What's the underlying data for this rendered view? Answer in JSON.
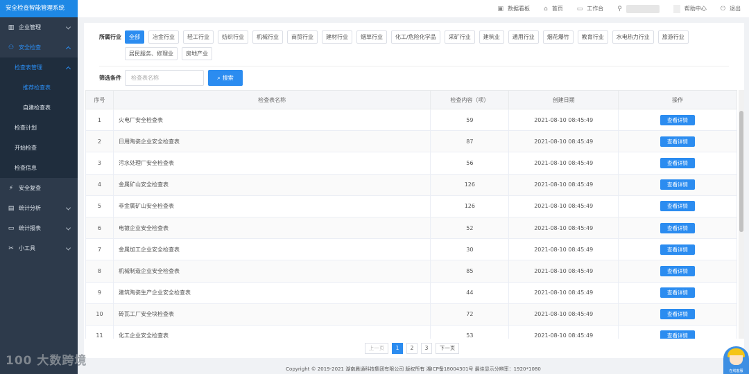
{
  "app": {
    "title": "安全检查智能管理系统"
  },
  "header": {
    "items": [
      {
        "label": "数据看板",
        "icon": "monitor-icon"
      },
      {
        "label": "首页",
        "icon": "home-icon"
      },
      {
        "label": "工作台",
        "icon": "desktop-icon"
      },
      {
        "label": "帮助中心",
        "icon": "help-icon"
      },
      {
        "label": "退出",
        "icon": "power-icon"
      }
    ]
  },
  "sidebar": {
    "items": [
      {
        "label": "企业管理",
        "icon": "building-icon"
      },
      {
        "label": "安全检查",
        "icon": "users-icon"
      },
      {
        "label": "检查表管理"
      },
      {
        "label": "推荐检查表"
      },
      {
        "label": "自建检查表"
      },
      {
        "label": "检查计划"
      },
      {
        "label": "开始检查"
      },
      {
        "label": "检查信息"
      },
      {
        "label": "安全复查",
        "icon": "bolt-icon"
      },
      {
        "label": "统计分析",
        "icon": "clipboard-icon"
      },
      {
        "label": "统计报表",
        "icon": "folder-icon"
      },
      {
        "label": "小工具",
        "icon": "tools-icon"
      }
    ]
  },
  "filter": {
    "label": "所属行业",
    "tags": [
      "全部",
      "冶金行业",
      "轻工行业",
      "纺织行业",
      "机械行业",
      "商贸行业",
      "建材行业",
      "烟草行业",
      "化工/危险化学品",
      "采矿行业",
      "建筑业",
      "通用行业",
      "烟花爆竹",
      "教育行业",
      "水电热力行业",
      "旅游行业",
      "居民服务、修理业",
      "房地产业"
    ],
    "active_index": 0
  },
  "search": {
    "label": "筛选条件",
    "placeholder": "检查表名称",
    "button": "搜索"
  },
  "table": {
    "headers": [
      "序号",
      "检查表名称",
      "检查内容（项）",
      "创建日期",
      "操作"
    ],
    "action_label": "查看详情",
    "rows": [
      {
        "no": "1",
        "name": "火电厂安全检查表",
        "count": "59",
        "date": "2021-08-10 08:45:49"
      },
      {
        "no": "2",
        "name": "日用陶瓷企业安全检查表",
        "count": "87",
        "date": "2021-08-10 08:45:49"
      },
      {
        "no": "3",
        "name": "污水处理厂安全检查表",
        "count": "56",
        "date": "2021-08-10 08:45:49"
      },
      {
        "no": "4",
        "name": "金属矿山安全检查表",
        "count": "126",
        "date": "2021-08-10 08:45:49"
      },
      {
        "no": "5",
        "name": "非金属矿山安全检查表",
        "count": "126",
        "date": "2021-08-10 08:45:49"
      },
      {
        "no": "6",
        "name": "电镀企业安全检查表",
        "count": "52",
        "date": "2021-08-10 08:45:49"
      },
      {
        "no": "7",
        "name": "金属加工企业安全检查表",
        "count": "30",
        "date": "2021-08-10 08:45:49"
      },
      {
        "no": "8",
        "name": "机械制造企业安全检查表",
        "count": "85",
        "date": "2021-08-10 08:45:49"
      },
      {
        "no": "9",
        "name": "建筑陶瓷生产企业安全检查表",
        "count": "44",
        "date": "2021-08-10 08:45:49"
      },
      {
        "no": "10",
        "name": "砖瓦工厂安全块检查表",
        "count": "72",
        "date": "2021-08-10 08:45:49"
      },
      {
        "no": "11",
        "name": "化工企业安全检查表",
        "count": "53",
        "date": "2021-08-10 08:45:49"
      }
    ]
  },
  "pagination": {
    "prev": "上一页",
    "next": "下一页",
    "pages": [
      "1",
      "2",
      "3"
    ],
    "current": "1"
  },
  "footer": {
    "text": "Copyright © 2019-2021 湖南晨通科技集团有限公司 版权所有 湘ICP备18004301号 最佳显示分辨率：1920*1080"
  },
  "watermark": {
    "text": "100 大数跨境"
  },
  "mascot": {
    "label": "在线客服"
  },
  "colors": {
    "accent": "#2b8cf0",
    "sidebar": "#2d3a4b",
    "brand_bar": "#1e88e5"
  }
}
